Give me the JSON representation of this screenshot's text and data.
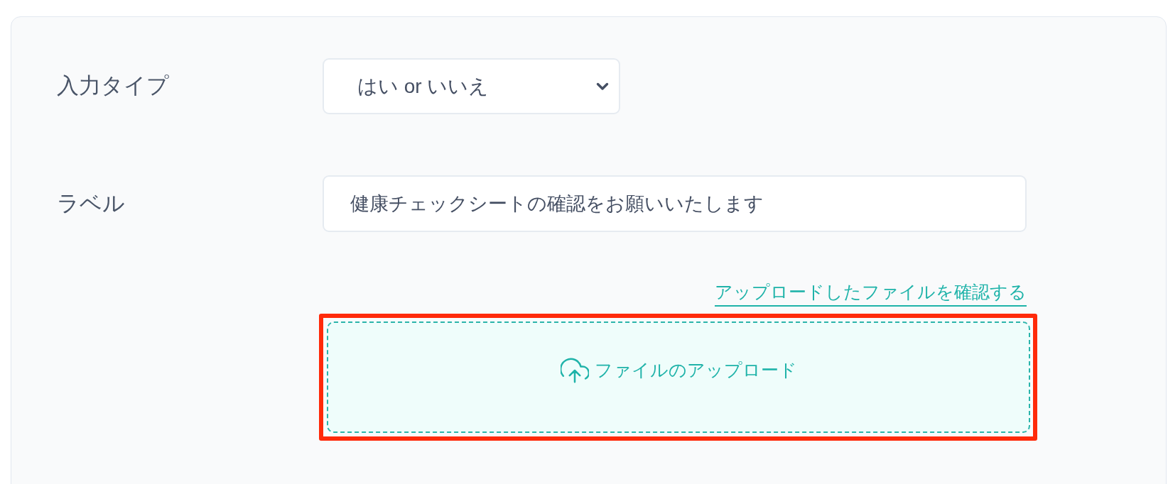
{
  "fields": [
    {
      "kind": "select",
      "label": "入力タイプ",
      "value": "はい or いいえ"
    },
    {
      "kind": "text",
      "label": "ラベル",
      "value": "健康チェックシートの確認をお願いいたします"
    }
  ],
  "link": {
    "label": "アップロードしたファイルを確認する"
  },
  "upload": {
    "label": "ファイルのアップロード",
    "highlighted": true
  }
}
